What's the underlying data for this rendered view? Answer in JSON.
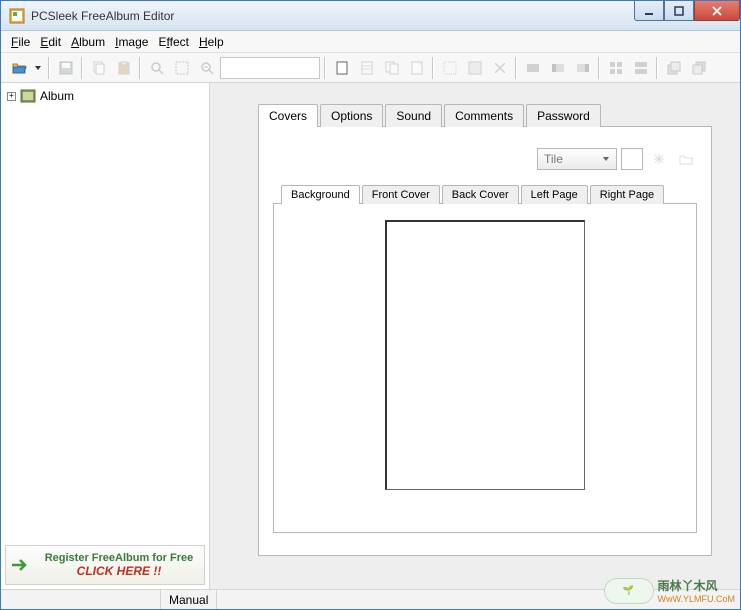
{
  "window": {
    "title": "PCSleek FreeAlbum Editor"
  },
  "menu": {
    "file": "File",
    "edit": "Edit",
    "album": "Album",
    "image": "Image",
    "effect": "Effect",
    "help": "Help"
  },
  "tree": {
    "root_label": "Album"
  },
  "register": {
    "line1": "Register FreeAlbum for Free",
    "line2": "CLICK HERE !!"
  },
  "tabs": {
    "covers": "Covers",
    "options": "Options",
    "sound": "Sound",
    "comments": "Comments",
    "password": "Password"
  },
  "tile_select": {
    "value": "Tile"
  },
  "subtabs": {
    "background": "Background",
    "front_cover": "Front Cover",
    "back_cover": "Back Cover",
    "left_page": "Left Page",
    "right_page": "Right Page"
  },
  "status": {
    "mode": "Manual"
  },
  "watermark": {
    "text1": "雨林丫木风",
    "text2": "WwW.YLMFU.CoM"
  }
}
